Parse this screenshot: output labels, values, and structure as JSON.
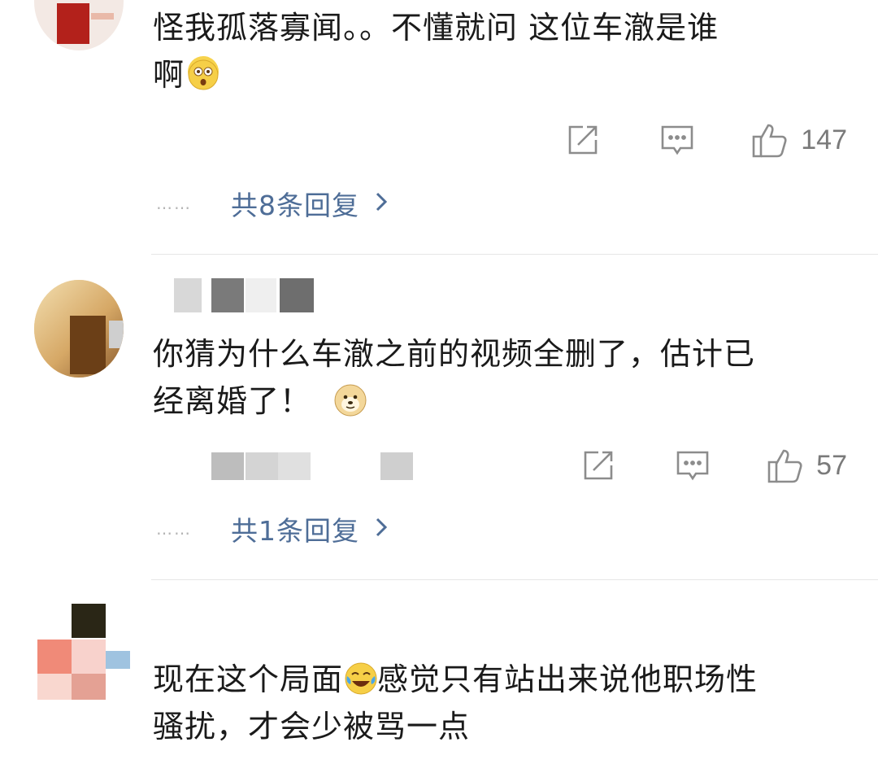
{
  "comments": [
    {
      "text": "怪我孤落寡闻。。不懂就问 这位车澈是谁",
      "text_line2": "啊",
      "emoji": "shocked-face-emoji",
      "like_count": "147",
      "replies_label": "共8条回复",
      "ellipsis": "……"
    },
    {
      "text": "你猜为什么车澈之前的视频全删了，估计已",
      "text_line2": "经离婚了！",
      "emoji": "doge-emoji",
      "like_count": "57",
      "replies_label": "共1条回复",
      "ellipsis": "……"
    },
    {
      "text": "现在这个局面",
      "text_after_emoji": "感觉只有站出来说他职场性",
      "text_line2": "骚扰，才会少被骂一点",
      "emoji": "crying-laughing-emoji"
    }
  ],
  "colors": {
    "reply_link": "#4e6d97",
    "count": "#7a7a7a",
    "divider": "#e6e6e6"
  }
}
